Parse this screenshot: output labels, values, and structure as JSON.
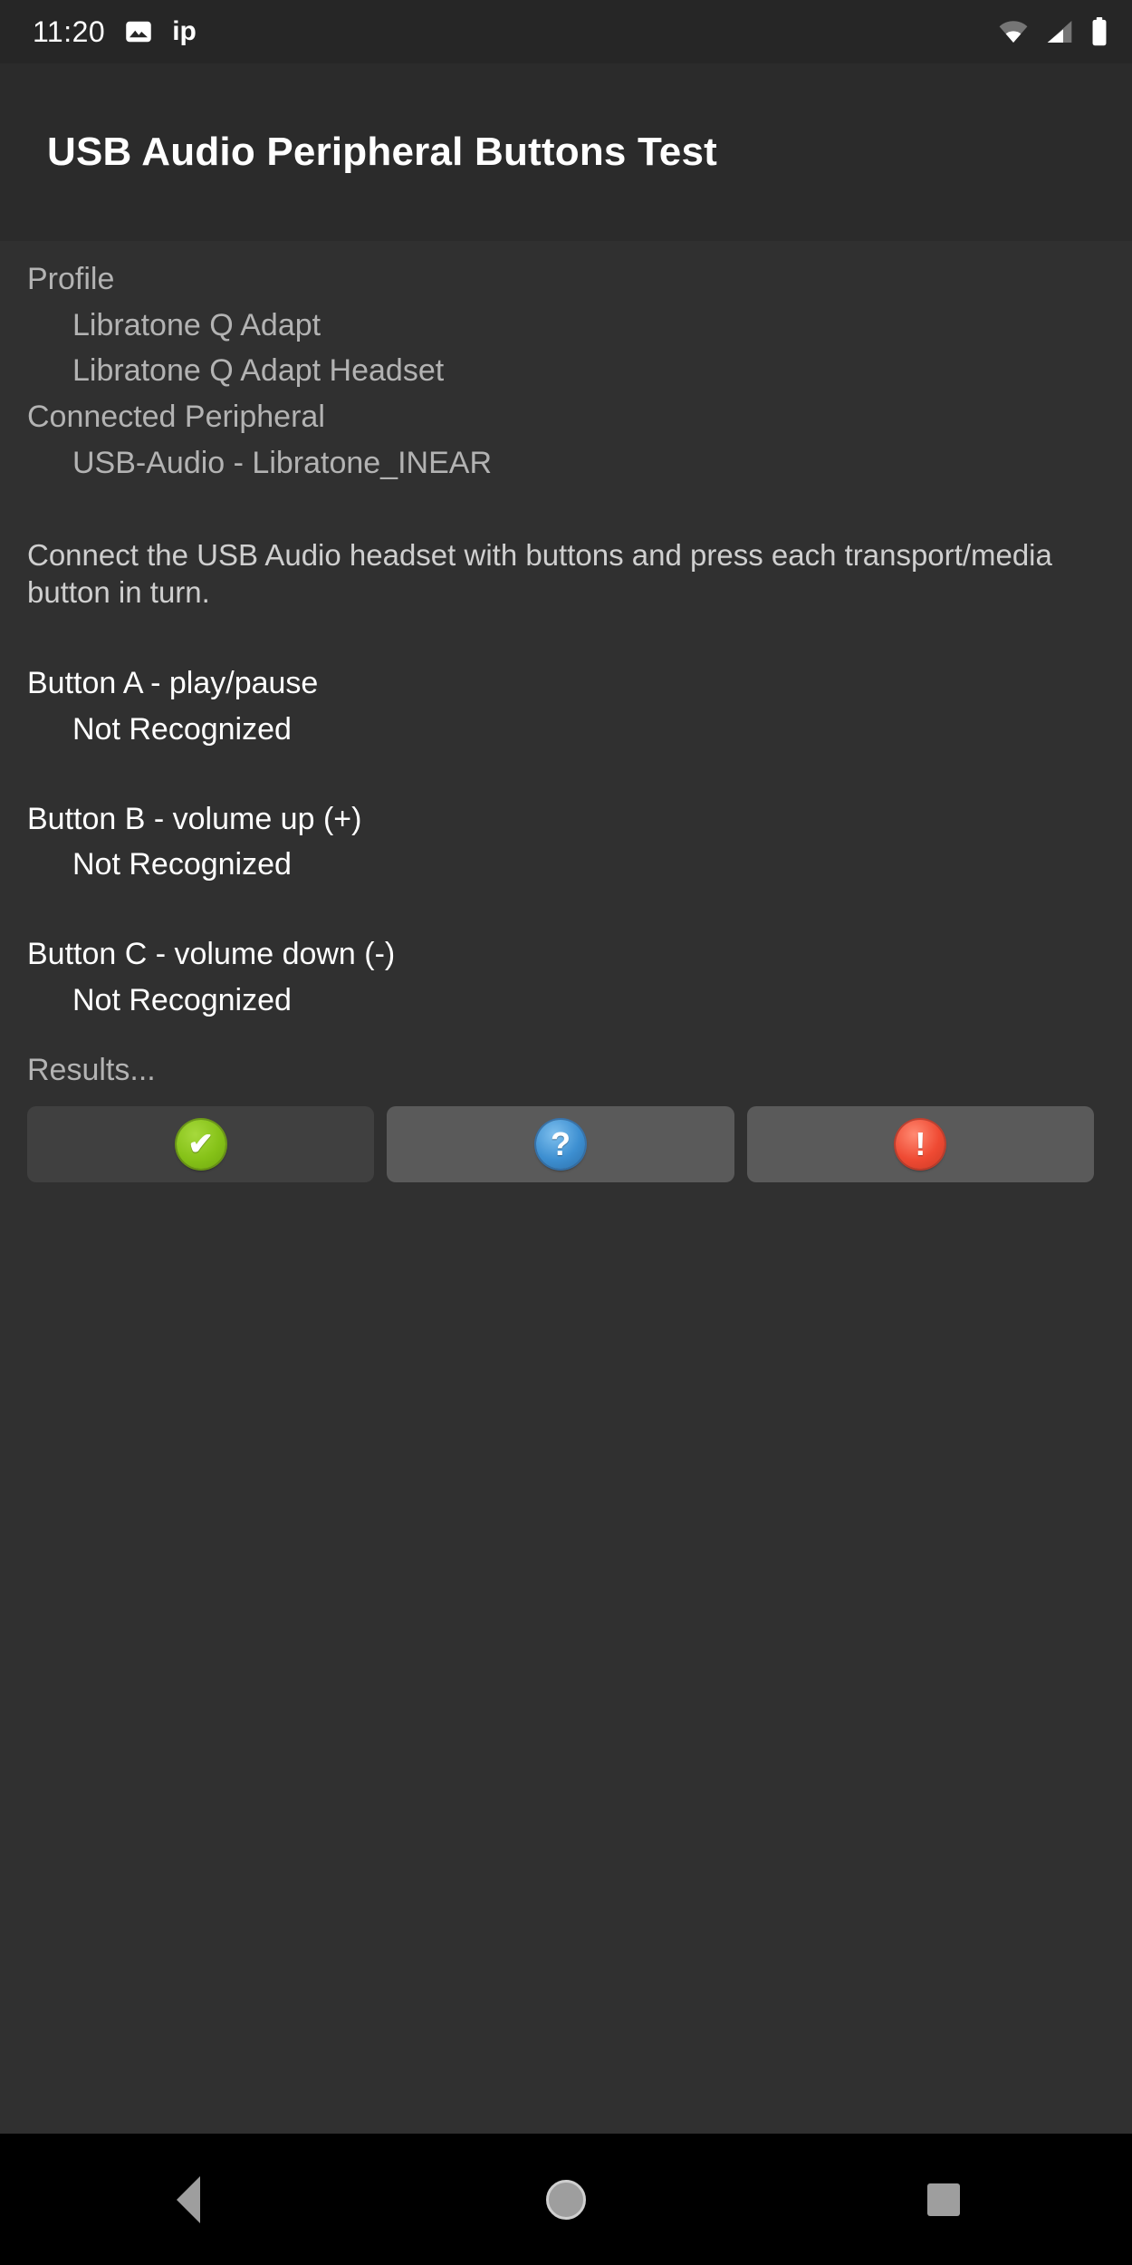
{
  "status_bar": {
    "clock": "11:20",
    "screenshot_icon": "image-icon",
    "ip_label": "ip",
    "wifi_icon": "wifi-icon",
    "cellular_icon": "cellular-signal-icon",
    "battery_icon": "battery-full-icon"
  },
  "app_bar": {
    "title": "USB Audio Peripheral Buttons Test"
  },
  "content": {
    "profile_label": "Profile",
    "profile_values": [
      "Libratone Q Adapt",
      "Libratone Q Adapt Headset"
    ],
    "connected_label": "Connected Peripheral",
    "connected_value": "USB-Audio - Libratone_INEAR",
    "instructions": "Connect the USB Audio headset with buttons and press each transport/media button in turn.",
    "tests": [
      {
        "label": "Button A - play/pause",
        "status": "Not Recognized"
      },
      {
        "label": "Button B - volume up (+)",
        "status": "Not Recognized"
      },
      {
        "label": "Button C - volume down (-)",
        "status": "Not Recognized"
      }
    ],
    "results_label": "Results..."
  },
  "result_buttons": [
    {
      "name": "pass-button",
      "icon": "check-circle-icon",
      "glyph": "✔",
      "state": "disabled",
      "color": "#86c218"
    },
    {
      "name": "info-button",
      "icon": "question-circle-icon",
      "glyph": "?",
      "state": "enabled",
      "color": "#3d8fd1"
    },
    {
      "name": "fail-button",
      "icon": "exclamation-circle-icon",
      "glyph": "!",
      "state": "enabled",
      "color": "#ef4a33"
    }
  ],
  "nav_bar": {
    "back_icon": "back-triangle-icon",
    "home_icon": "home-circle-icon",
    "recents_icon": "recents-square-icon"
  },
  "theme": {
    "background": "#303030",
    "app_bar_background": "#2b2b2b",
    "status_bar_background": "#262626",
    "nav_bar_background": "#000000",
    "primary_text": "#ffffff",
    "secondary_text": "#b3b3b3"
  }
}
